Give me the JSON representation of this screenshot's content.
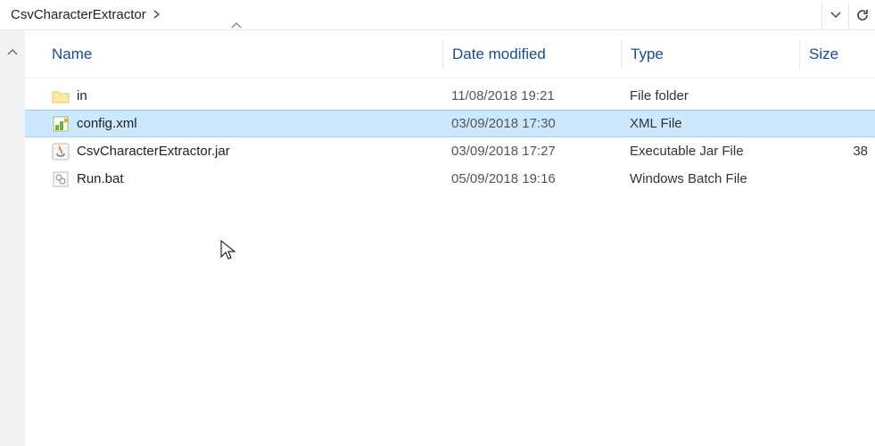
{
  "breadcrumb": {
    "segment": "CsvCharacterExtractor"
  },
  "columns": {
    "name": "Name",
    "date": "Date modified",
    "type": "Type",
    "size": "Size"
  },
  "rows": [
    {
      "icon": "folder",
      "name": "in",
      "date": "11/08/2018 19:21",
      "type": "File folder",
      "size": "",
      "selected": false,
      "id": "in"
    },
    {
      "icon": "xml",
      "name": "config.xml",
      "date": "03/09/2018 17:30",
      "type": "XML File",
      "size": "",
      "selected": true,
      "id": "config-xml"
    },
    {
      "icon": "jar",
      "name": "CsvCharacterExtractor.jar",
      "date": "03/09/2018 17:27",
      "type": "Executable Jar File",
      "size": "38",
      "selected": false,
      "id": "csvcharacterextractor-jar"
    },
    {
      "icon": "bat",
      "name": "Run.bat",
      "date": "05/09/2018 19:16",
      "type": "Windows Batch File",
      "size": "",
      "selected": false,
      "id": "run-bat"
    }
  ]
}
